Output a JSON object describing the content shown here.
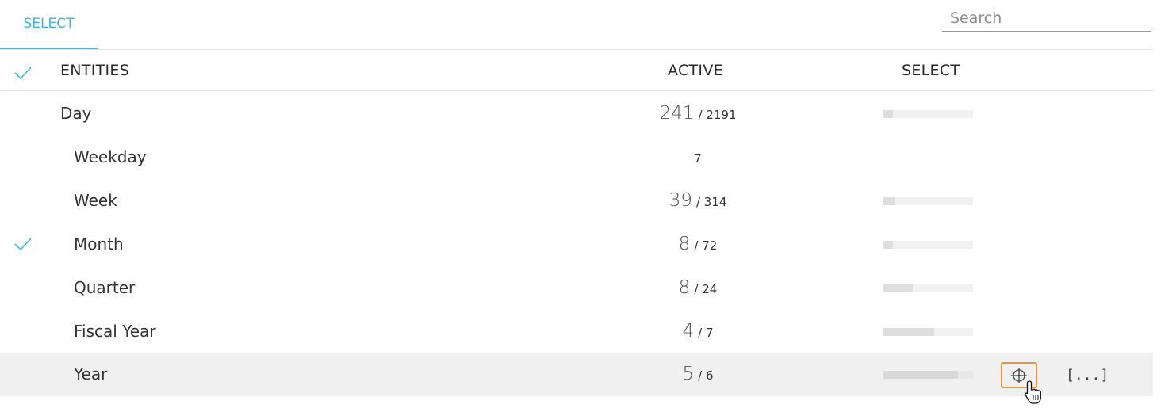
{
  "tabs": {
    "select_label": "SELECT"
  },
  "search": {
    "placeholder": "Search",
    "value": ""
  },
  "table": {
    "headers": {
      "entities": "ENTITIES",
      "active": "ACTIVE",
      "select": "SELECT"
    },
    "rows": [
      {
        "name": "Day",
        "active": "241",
        "total": "/ 2191",
        "checked": false,
        "select_fraction": 0.11
      },
      {
        "name": "Weekday",
        "active": "",
        "total": "7",
        "checked": false,
        "select_fraction": null
      },
      {
        "name": "Week",
        "active": "39",
        "total": "/ 314",
        "checked": false,
        "select_fraction": 0.12
      },
      {
        "name": "Month",
        "active": "8",
        "total": "/ 72",
        "checked": true,
        "select_fraction": 0.11
      },
      {
        "name": "Quarter",
        "active": "8",
        "total": "/ 24",
        "checked": false,
        "select_fraction": 0.33
      },
      {
        "name": "Fiscal Year",
        "active": "4",
        "total": "/ 7",
        "checked": false,
        "select_fraction": 0.57
      },
      {
        "name": "Year",
        "active": "5",
        "total": "/ 6",
        "checked": false,
        "select_fraction": 0.83
      }
    ],
    "hover_actions": {
      "more_label": "[...]"
    }
  },
  "icons": {
    "check": "checkmark-icon",
    "crosshair": "crosshair-icon",
    "cursor": "hand-cursor-icon"
  },
  "colors": {
    "accent": "#3fb7d9",
    "hover_outline": "#f0913c",
    "row_highlight": "#f0f0f0"
  }
}
